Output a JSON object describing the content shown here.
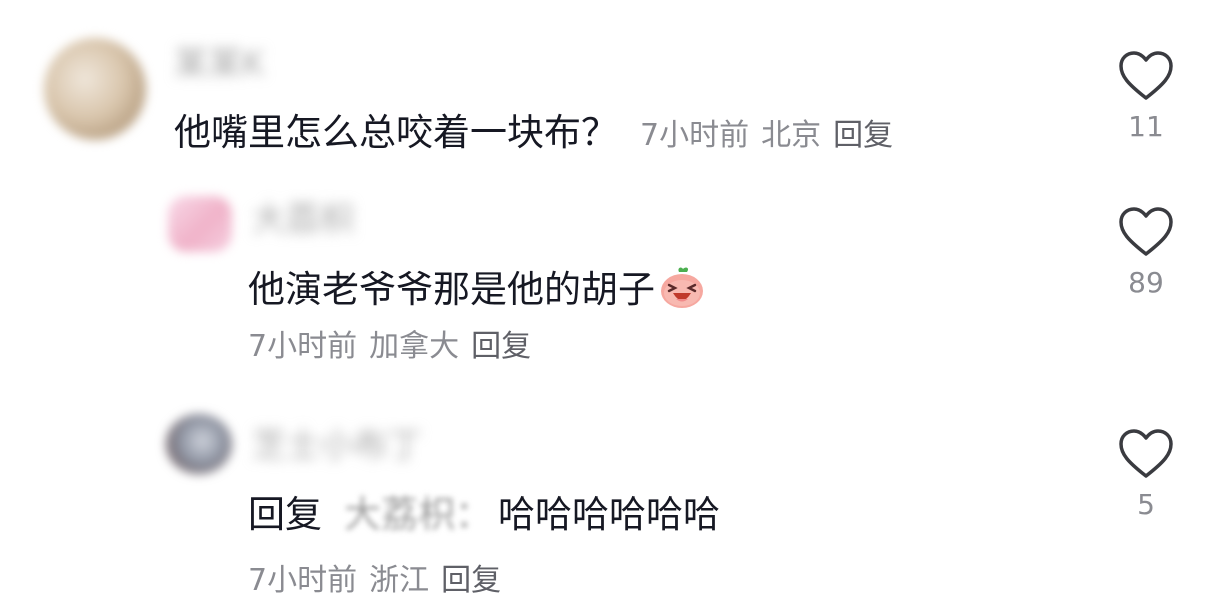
{
  "comments": [
    {
      "username": "某某K",
      "text": "他嘴里怎么总咬着一块布？",
      "time": "7小时前",
      "location": "北京",
      "reply_label": "回复",
      "likes": "11"
    },
    {
      "username": "大荔枳",
      "text": "他演老爷爷那是他的胡子",
      "time": "7小时前",
      "location": "加拿大",
      "reply_label": "回复",
      "likes": "89"
    },
    {
      "username": "芝士小布丁",
      "reply_prefix": "回复",
      "mention": "大荔枳：",
      "text": "哈哈哈哈哈哈",
      "time": "7小时前",
      "location": "浙江",
      "reply_label": "回复",
      "likes": "5"
    }
  ],
  "icons": {
    "like": "heart-outline-icon",
    "emoji": "laughing-peach-emoji"
  },
  "colors": {
    "text": "#161823",
    "meta": "#8a8b91",
    "heart_stroke": "#3a3b40"
  }
}
